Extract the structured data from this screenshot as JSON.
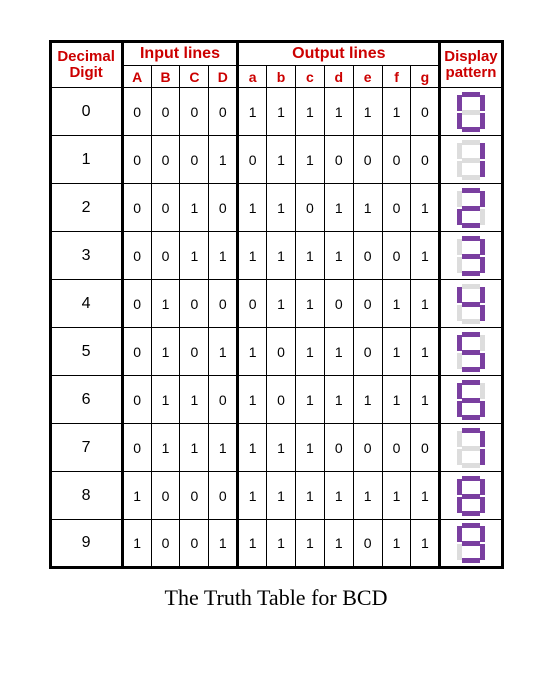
{
  "headers": {
    "decimal": "Decimal",
    "digit": "Digit",
    "input": "Input lines",
    "output": "Output lines",
    "display": "Display",
    "pattern": "pattern",
    "cols_in": [
      "A",
      "B",
      "C",
      "D"
    ],
    "cols_out": [
      "a",
      "b",
      "c",
      "d",
      "e",
      "f",
      "g"
    ]
  },
  "chart_data": {
    "type": "table",
    "title": "The Truth Table for BCD",
    "columns": [
      "Decimal Digit",
      "A",
      "B",
      "C",
      "D",
      "a",
      "b",
      "c",
      "d",
      "e",
      "f",
      "g"
    ],
    "rows": [
      {
        "dec": 0,
        "in": [
          0,
          0,
          0,
          0
        ],
        "out": [
          1,
          1,
          1,
          1,
          1,
          1,
          0
        ]
      },
      {
        "dec": 1,
        "in": [
          0,
          0,
          0,
          1
        ],
        "out": [
          0,
          1,
          1,
          0,
          0,
          0,
          0
        ]
      },
      {
        "dec": 2,
        "in": [
          0,
          0,
          1,
          0
        ],
        "out": [
          1,
          1,
          0,
          1,
          1,
          0,
          1
        ]
      },
      {
        "dec": 3,
        "in": [
          0,
          0,
          1,
          1
        ],
        "out": [
          1,
          1,
          1,
          1,
          0,
          0,
          1
        ]
      },
      {
        "dec": 4,
        "in": [
          0,
          1,
          0,
          0
        ],
        "out": [
          0,
          1,
          1,
          0,
          0,
          1,
          1
        ]
      },
      {
        "dec": 5,
        "in": [
          0,
          1,
          0,
          1
        ],
        "out": [
          1,
          0,
          1,
          1,
          0,
          1,
          1
        ]
      },
      {
        "dec": 6,
        "in": [
          0,
          1,
          1,
          0
        ],
        "out": [
          1,
          0,
          1,
          1,
          1,
          1,
          1
        ]
      },
      {
        "dec": 7,
        "in": [
          0,
          1,
          1,
          1
        ],
        "out": [
          1,
          1,
          1,
          0,
          0,
          0,
          0
        ]
      },
      {
        "dec": 8,
        "in": [
          1,
          0,
          0,
          0
        ],
        "out": [
          1,
          1,
          1,
          1,
          1,
          1,
          1
        ]
      },
      {
        "dec": 9,
        "in": [
          1,
          0,
          0,
          1
        ],
        "out": [
          1,
          1,
          1,
          1,
          0,
          1,
          1
        ]
      }
    ]
  },
  "caption": "The Truth Table for BCD"
}
